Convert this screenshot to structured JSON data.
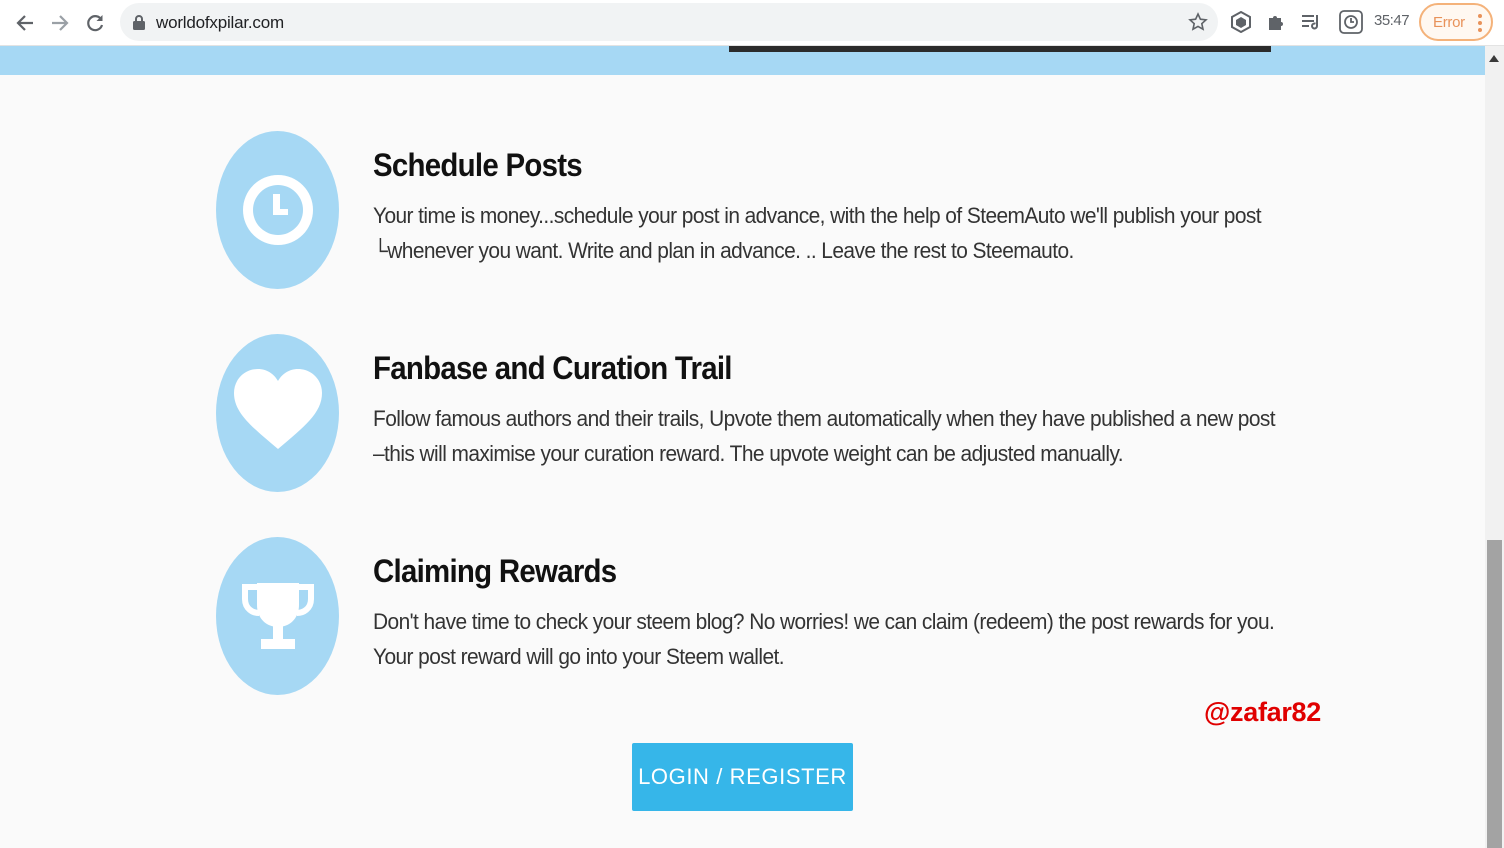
{
  "browser": {
    "url": "worldofxpilar.com",
    "clock": "35:47",
    "error_label": "Error",
    "icons": [
      "back-icon",
      "forward-icon",
      "reload-icon",
      "lock-icon",
      "star-icon",
      "extension-hexagon-icon",
      "puzzle-icon",
      "reading-list-icon",
      "clock-badge-icon",
      "menu-dots-icon"
    ]
  },
  "features": [
    {
      "icon": "clock-icon",
      "title": "Schedule Posts",
      "lines": [
        "Your time is money...schedule your post in advance, with the help of SteemAuto we'll publish your post",
        "└whenever you want. Write and plan in advance. .. Leave the rest to Steemauto."
      ]
    },
    {
      "icon": "heart-icon",
      "title": "Fanbase and Curation Trail",
      "lines": [
        "Follow famous authors and their trails, Upvote them automatically when they have published a new post",
        "–this will maximise your curation reward. The upvote weight can be adjusted manually."
      ]
    },
    {
      "icon": "trophy-icon",
      "title": "Claiming Rewards",
      "lines": [
        "Don't have time to check your steem blog? No worries! we can claim (redeem) the post rewards for you.",
        "Your post reward will go into your Steem wallet."
      ]
    }
  ],
  "watermark": "@zafar82",
  "login_button": "LOGIN / REGISTER",
  "colors": {
    "accent_light": "#a6d8f4",
    "button": "#36b6e9",
    "watermark": "#e00000",
    "error_pill": "#e8925a"
  }
}
